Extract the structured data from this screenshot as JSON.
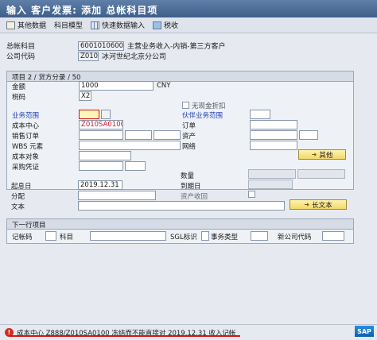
{
  "window": {
    "title": "输入 客户发票: 添加 总帐科目项"
  },
  "toolbar": {
    "other_data": "其他数据",
    "account_model": "科目模型",
    "fast_entry": "快速数据输入",
    "tax": "税收"
  },
  "header": {
    "gl_account_label": "总帐科目",
    "gl_account_value": "6001010600",
    "gl_account_desc": "主营业务收入-内销-第三方客户",
    "company_code_label": "公司代码",
    "company_code_value": "Z010",
    "company_code_desc": "冰河世纪北京分公司"
  },
  "item_panel": {
    "title": "项目 2 / 贷方分录 / 50",
    "amount_label": "金额",
    "amount_value": "1000",
    "currency": "CNY",
    "tax_code_label": "税码",
    "tax_code_value": "X2",
    "cash_discount_label": "无现金折扣",
    "business_area_label": "业务范围",
    "partner_business_area_label": "伙伴业务范围",
    "cost_center_label": "成本中心",
    "cost_center_value": "Z010SA0100",
    "order_label": "订单",
    "sales_order_label": "销售订单",
    "asset_label": "资产",
    "wbs_label": "WBS 元素",
    "network_label": "网络",
    "cost_object_label": "成本对象",
    "purchase_doc_label": "采购凭证",
    "more_button": "其他",
    "quantity_label": "数量",
    "value_date_label": "起息日",
    "value_date_value": "2019.12.31",
    "due_date_label": "到期日",
    "assignment_label": "分配",
    "asset_retirement_label": "资产收回",
    "text_label": "文本",
    "long_text_button": "长文本"
  },
  "next_item": {
    "title": "下一行项目",
    "posting_key_label": "记帐码",
    "account_label": "科目",
    "sgl_label": "SGL标识",
    "transaction_type_label": "事务类型",
    "new_company_label": "新公司代码"
  },
  "status": {
    "message": "成本中心 Z888/Z010SA0100 冻结而不能直接对 2019.12.31 收入记帐"
  },
  "brand": {
    "logo": "SAP"
  },
  "colors": {
    "title_bar": "#3f5f8b",
    "error": "#d12b1f",
    "highlight": "#d2141e"
  }
}
